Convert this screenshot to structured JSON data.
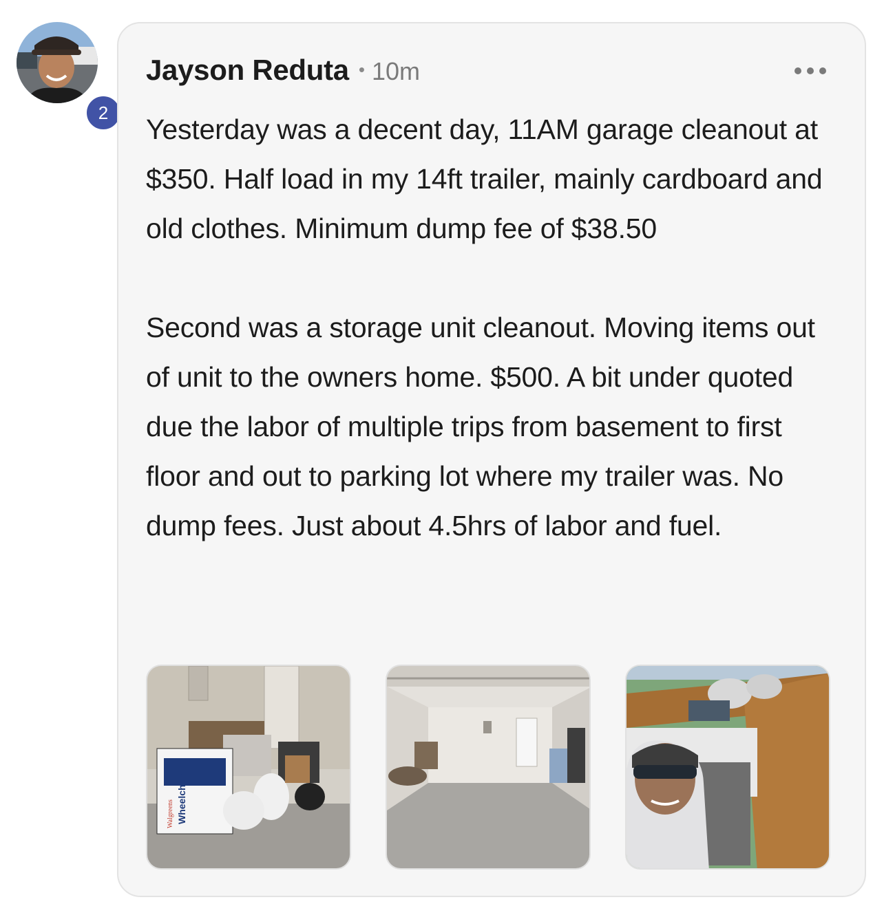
{
  "post": {
    "author": "Jayson Reduta",
    "separator": "•",
    "time": "10m",
    "badge_count": "2",
    "paragraphs": [
      "Yesterday was a decent day, 11AM garage cleanout at $350. Half load in my 14ft trailer, mainly cardboard and old clothes. Minimum dump fee of $38.50",
      "Second was a storage unit cleanout. Moving items out of unit to the owners home. $500. A bit under quoted due the labor of multiple trips from basement to first floor and out to parking lot where my trailer was. No dump fees. Just about 4.5hrs of labor and fuel."
    ],
    "photos": [
      {
        "label": "Wheelchair",
        "brand": "Walgreens"
      },
      {
        "label": ""
      },
      {
        "label": ""
      }
    ]
  },
  "icons": {
    "more": "more-horizontal-icon"
  },
  "colors": {
    "badge": "#4153a6",
    "card_background": "#f6f6f6",
    "text": "#1c1c1c",
    "muted": "#7a7a7a"
  }
}
